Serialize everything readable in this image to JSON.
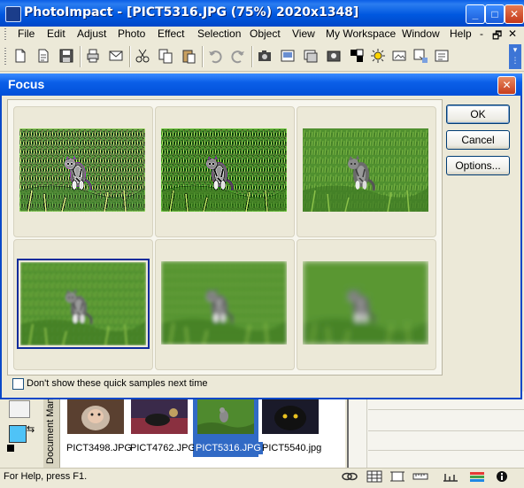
{
  "app": {
    "title": "PhotoImpact - [PICT5316.JPG (75%) 2020x1348]",
    "controls": {
      "minimize": "_",
      "maximize": "□",
      "close": "✕"
    }
  },
  "menubar": {
    "items": [
      "File",
      "Edit",
      "Adjust",
      "Photo",
      "Effect",
      "Selection",
      "Object",
      "View",
      "My Workspace",
      "Window",
      "Help"
    ],
    "right_controls": [
      "-",
      "🗗",
      "✕"
    ]
  },
  "toolbar": {
    "icons": [
      "new-icon",
      "open-icon",
      "save-icon",
      "print-icon",
      "mail-icon",
      "cut-icon",
      "copy-icon",
      "paste-icon",
      "undo-icon",
      "redo-icon",
      "camera-icon",
      "scan-icon",
      "effect-icon",
      "photo-icon",
      "mask-icon",
      "brightness-icon",
      "image-icon",
      "export-icon",
      "settings-icon"
    ]
  },
  "dialog": {
    "title": "Focus",
    "close": "✕",
    "buttons": {
      "ok": "OK",
      "cancel": "Cancel",
      "options": "Options..."
    },
    "checkbox_label": "Don't show these quick samples next time",
    "checkbox_checked": false,
    "samples": [
      "sharpen-strong",
      "sharpen-medium",
      "sharpen-light",
      "blur-light",
      "blur-medium",
      "blur-strong"
    ],
    "selected_sample": 3
  },
  "document_manager": {
    "label": "Document Manager",
    "thumbnails": [
      {
        "name": "PICT3498.JPG",
        "selected": false
      },
      {
        "name": "PICT4762.JPG",
        "selected": false
      },
      {
        "name": "PICT5316.JPG",
        "selected": true
      },
      {
        "name": "PICT5540.jpg",
        "selected": false
      }
    ]
  },
  "status": {
    "text": "For Help, press F1."
  },
  "colors": {
    "titlebar": "#0058e0",
    "selection": "#316ac5",
    "dialog_bg": "#ece9d8"
  }
}
